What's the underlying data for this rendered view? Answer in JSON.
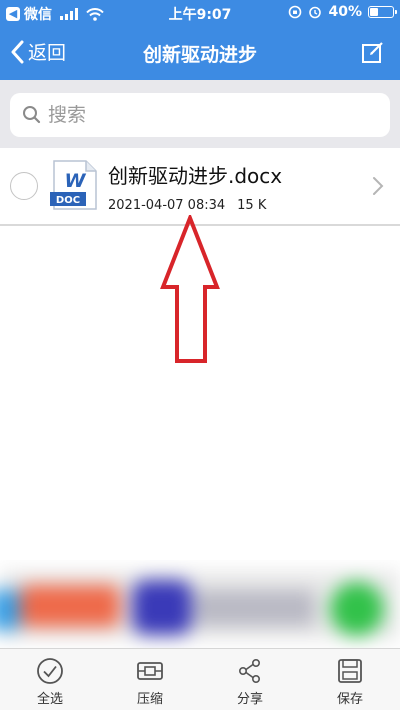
{
  "status_bar": {
    "back_app": "微信",
    "time": "上午9:07",
    "battery": "40%",
    "battery_level": 0.4
  },
  "nav": {
    "back_label": "返回",
    "title": "创新驱动进步",
    "edit_icon": "compose-icon"
  },
  "search": {
    "placeholder": "搜索"
  },
  "file": {
    "name": "创新驱动进步.docx",
    "icon_letter": "W",
    "icon_badge": "DOC",
    "modified": "2021-04-07 08:34",
    "size": "15 K"
  },
  "toolbar": {
    "items": [
      {
        "label": "全选",
        "icon": "check-circle-icon"
      },
      {
        "label": "压缩",
        "icon": "compress-icon"
      },
      {
        "label": "分享",
        "icon": "share-icon"
      },
      {
        "label": "保存",
        "icon": "save-icon"
      }
    ]
  },
  "colors": {
    "header": "#3d8be3",
    "annotation": "#d8252a",
    "doc_blue": "#2b63b8"
  }
}
